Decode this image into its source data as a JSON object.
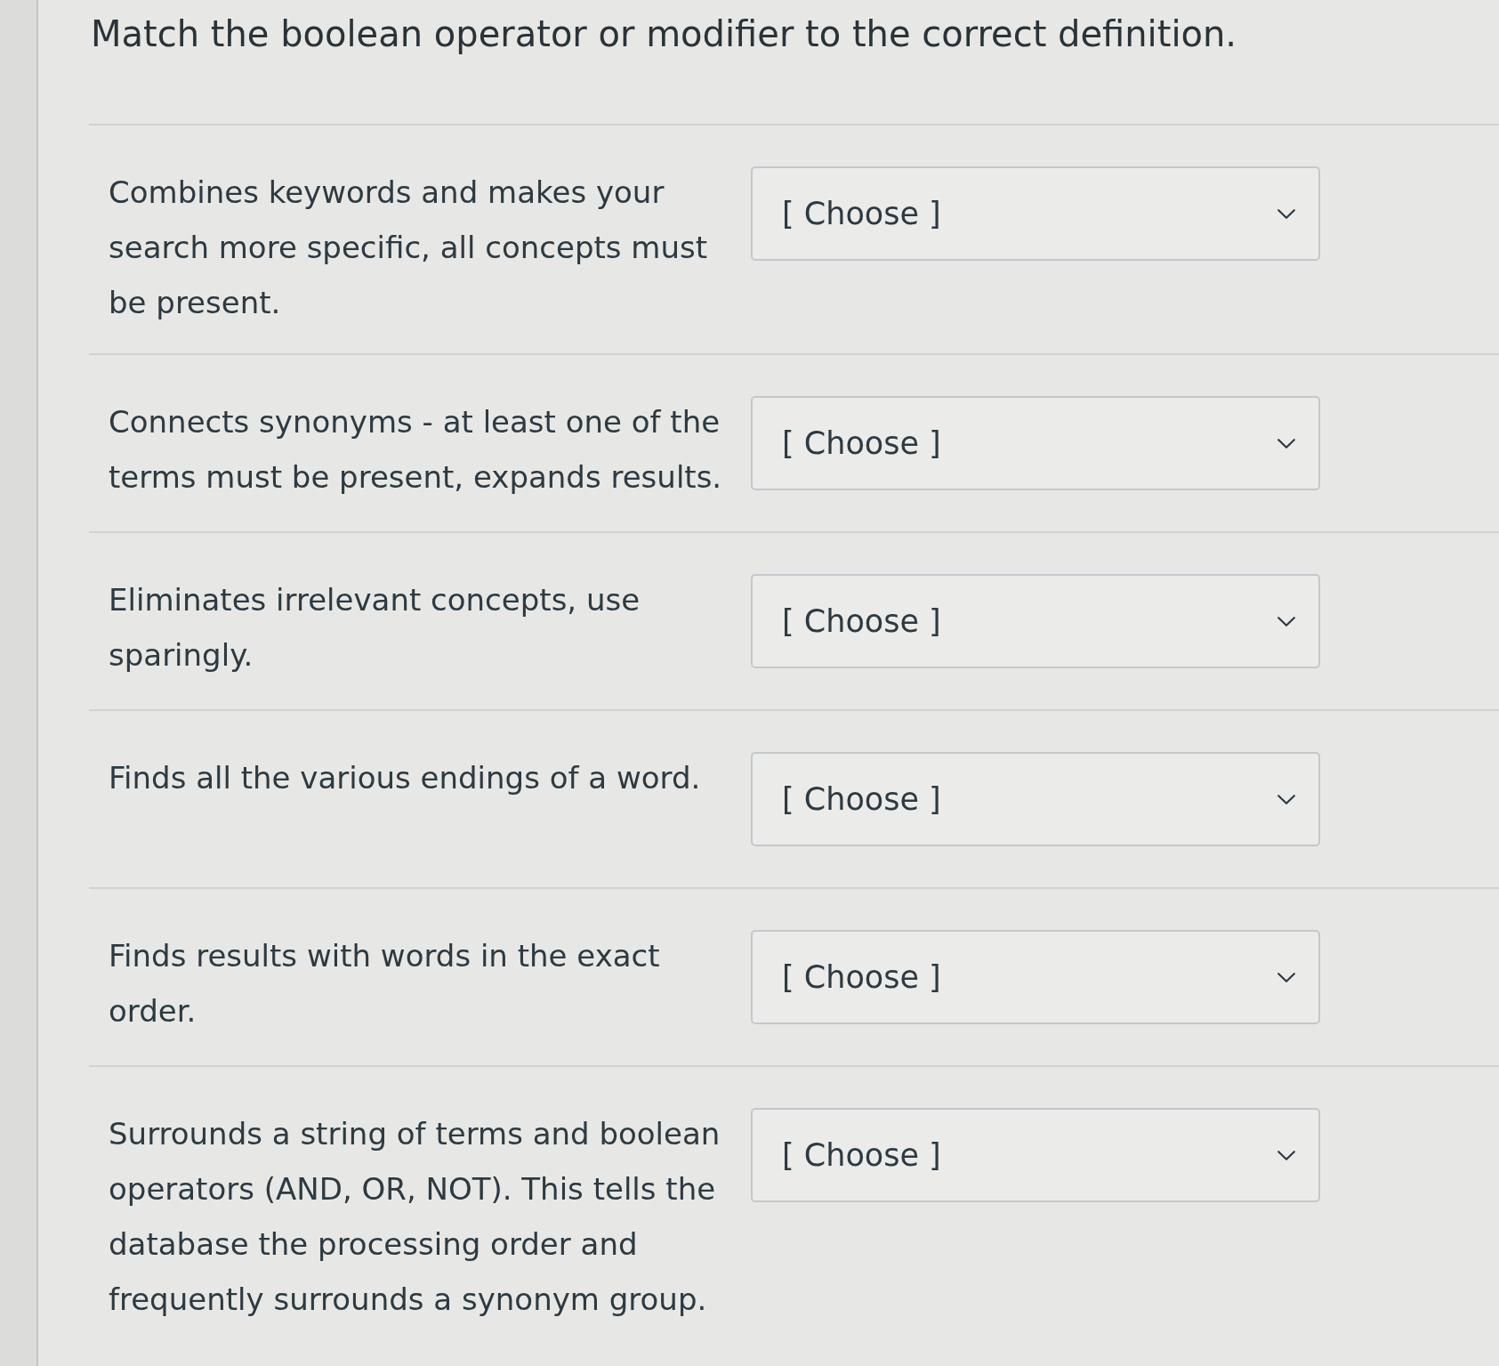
{
  "question": {
    "prompt": "Match the boolean operator or modifier to the correct definition."
  },
  "items": [
    {
      "definition": "Combines keywords and makes your search more specific, all concepts must be present.",
      "answer": {
        "value": "[ Choose ]"
      }
    },
    {
      "definition": "Connects synonyms - at least one of the terms must be present, expands results.",
      "answer": {
        "value": "[ Choose ]"
      }
    },
    {
      "definition": "Eliminates irrelevant concepts, use sparingly.",
      "answer": {
        "value": "[ Choose ]"
      }
    },
    {
      "definition": "Finds all the various endings of a word.",
      "answer": {
        "value": "[ Choose ]"
      }
    },
    {
      "definition": "Finds results with words in the exact order.",
      "answer": {
        "value": "[ Choose ]"
      }
    },
    {
      "definition": "Surrounds a string of terms and boolean operators (AND, OR, NOT). This tells the database the processing order and frequently surrounds a synonym group.",
      "answer": {
        "value": "[ Choose ]"
      }
    }
  ]
}
